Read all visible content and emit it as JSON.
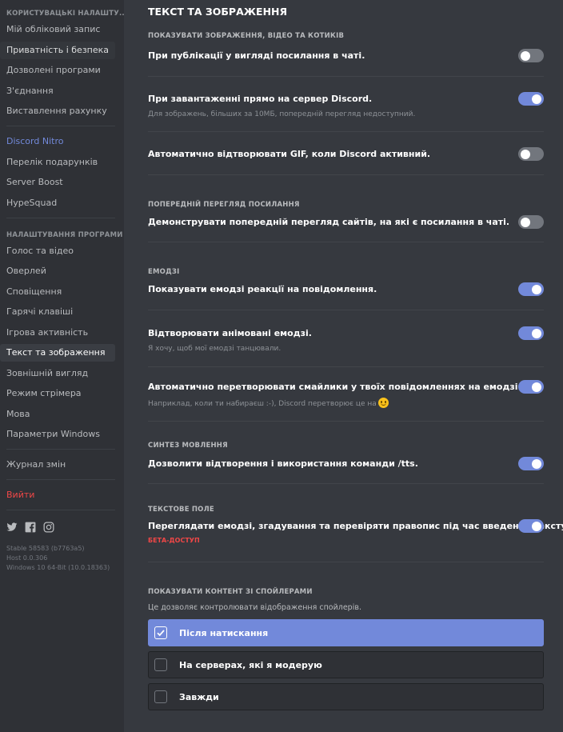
{
  "sidebar": {
    "header_user": "КОРИСТУВАЦЬКІ НАЛАШТУ...",
    "user_items": [
      "Мій обліковий запис",
      "Приватність і безпека",
      "Дозволені програми",
      "З'єднання",
      "Виставлення рахунку"
    ],
    "nitro_items": [
      "Discord Nitro",
      "Перелік подарунків",
      "Server Boost",
      "HypeSquad"
    ],
    "header_app": "НАЛАШТУВАННЯ ПРОГРАМИ",
    "app_items": [
      "Голос та відео",
      "Оверлей",
      "Сповіщення",
      "Гарячі клавіші",
      "Ігрова активність",
      "Текст та зображення",
      "Зовнішній вигляд",
      "Режим стрімера",
      "Мова",
      "Параметри Windows"
    ],
    "changelog": "Журнал змін",
    "logout": "Вийти",
    "social_icons": [
      "twitter-icon",
      "facebook-icon",
      "instagram-icon"
    ],
    "version_lines": [
      "Stable 58583 (b7763a5)",
      "Host 0.0.306",
      "Windows 10 64-Bit (10.0.18363)"
    ]
  },
  "main": {
    "title": "ТЕКСТ ТА ЗОБРАЖЕННЯ",
    "sections": {
      "display_images": "ПОКАЗУВАТИ ЗОБРАЖЕННЯ, ВІДЕО ТА КОТИКІВ",
      "link_preview": "ПОПЕРЕДНІЙ ПЕРЕГЛЯД ПОСИЛАННЯ",
      "emoji": "ЕМОДЗІ",
      "tts": "СИНТЕЗ МОВЛЕННЯ",
      "text_box": "ТЕКСТОВЕ ПОЛЕ",
      "spoilers": "ПОКАЗУВАТИ КОНТЕНТ ЗІ СПОЙЛЕРАМИ"
    },
    "settings": {
      "inline_links": {
        "label": "При публікації у вигляді посилання в чаті.",
        "on": false
      },
      "inline_uploads": {
        "label": "При завантаженні прямо на сервер Discord.",
        "note": "Для зображень, більших за 10МБ, попередній перегляд недоступний.",
        "on": true
      },
      "autoplay_gif": {
        "label": "Автоматично відтворювати GIF, коли Discord активний.",
        "on": false
      },
      "embeds": {
        "label": "Демонструвати попередній перегляд сайтів, на які є посилання в чаті.",
        "on": false
      },
      "reactions": {
        "label": "Показувати емодзі реакції на повідомлення.",
        "on": true
      },
      "animate_emoji": {
        "label": "Відтворювати анімовані емодзі.",
        "note": "Я хочу, щоб мої емодзі танцювали.",
        "on": true
      },
      "convert_emoticons": {
        "label": "Автоматично перетворювати смайлики у твоїх повідомленнях на емодзі.",
        "note": "Наприклад, коли ти набираєш :-), Discord перетворює це на",
        "on": true
      },
      "tts_command": {
        "label": "Дозволити відтворення і використання команди /tts.",
        "on": true
      },
      "emoji_picker": {
        "label": "Переглядати емодзі, згадування та перевіряти правопис під час введення тексту.",
        "badge": "БЕТА-ДОСТУП",
        "on": true
      }
    },
    "spoiler_desc": "Це дозволяє контролювати відображення спойлерів.",
    "spoiler_options": [
      {
        "label": "Після натискання",
        "checked": true
      },
      {
        "label": "На серверах, які я модерую",
        "checked": false
      },
      {
        "label": "Завжди",
        "checked": false
      }
    ],
    "colors": {
      "accent": "#7289da",
      "danger": "#f04747",
      "toggle_off": "#72767d"
    }
  }
}
